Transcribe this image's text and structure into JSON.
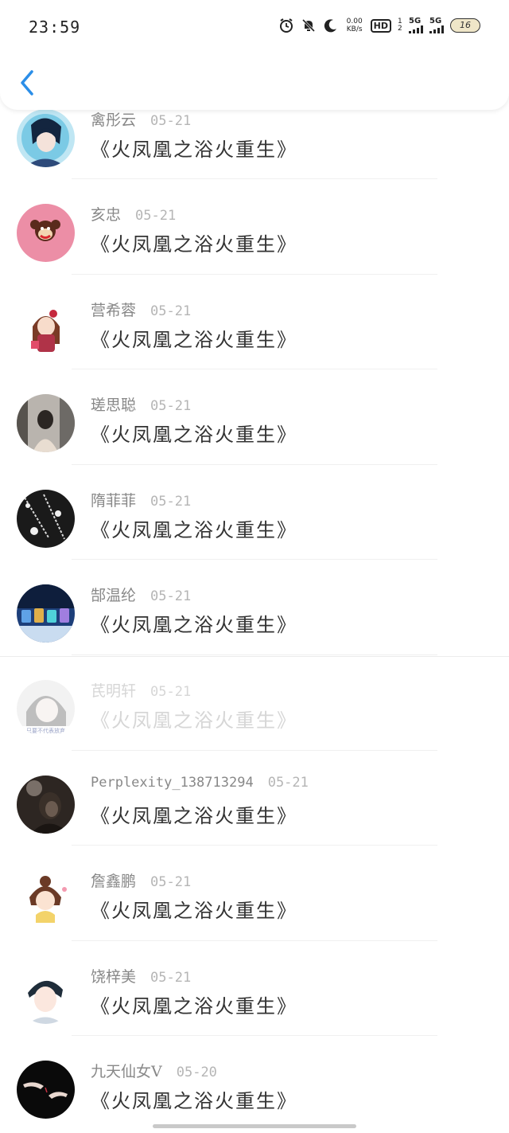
{
  "status_bar": {
    "time": "23:59",
    "net_speed_value": "0.00",
    "net_speed_unit": "KB/s",
    "hd_label": "HD",
    "hd_sub": "1 2",
    "signal1_label": "5G",
    "signal2_label": "5G",
    "battery_level": "16",
    "icons": [
      "alarm-icon",
      "bell-muted-icon",
      "moon-icon"
    ]
  },
  "header": {
    "back_icon": "chevron-left-icon",
    "accent_color": "#2b8ee8"
  },
  "comments": [
    {
      "name": "禽彤云",
      "date": "05-21",
      "message": "《火凤凰之浴火重生》"
    },
    {
      "name": "亥忠",
      "date": "05-21",
      "message": "《火凤凰之浴火重生》"
    },
    {
      "name": "营希蓉",
      "date": "05-21",
      "message": "《火凤凰之浴火重生》"
    },
    {
      "name": "瑳思聪",
      "date": "05-21",
      "message": "《火凤凰之浴火重生》"
    },
    {
      "name": "隋菲菲",
      "date": "05-21",
      "message": "《火凤凰之浴火重生》"
    },
    {
      "name": "郜温纶",
      "date": "05-21",
      "message": "《火凤凰之浴火重生》"
    },
    {
      "name": "芪明轩",
      "date": "05-21",
      "message": "《火凤凰之浴火重生》"
    },
    {
      "name": "Perplexity_138713294",
      "date": "05-21",
      "message": "《火凤凰之浴火重生》"
    },
    {
      "name": "詹鑫鹏",
      "date": "05-21",
      "message": "《火凤凰之浴火重生》"
    },
    {
      "name": "饶梓美",
      "date": "05-21",
      "message": "《火凤凰之浴火重生》"
    },
    {
      "name": "九天仙女V",
      "date": "05-20",
      "message": "《火凤凰之浴火重生》"
    }
  ],
  "avatar_badge_text": "只要不代表放弃"
}
